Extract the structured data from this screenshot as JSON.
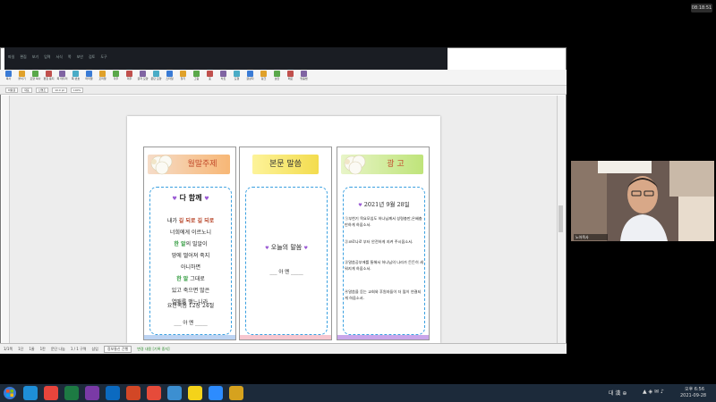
{
  "clock_top": "08:18:51",
  "word": {
    "menu_tabs": [
      "파일",
      "편집",
      "보기",
      "입력",
      "서식",
      "쪽",
      "보안",
      "검토",
      "도구"
    ],
    "ribbon_labels": [
      "복사",
      "붙이기",
      "모양 복사",
      "편집 용지",
      "쪽 테두리",
      "쪽 번호",
      "머리말",
      "꼬리말",
      "각주",
      "미주",
      "글자 모양",
      "문단 모양",
      "스타일",
      "찾기",
      "그림",
      "표",
      "차트",
      "도형",
      "글상자",
      "링크",
      "보안",
      "메모",
      "맞춤법"
    ],
    "format_fields": [
      "바탕글",
      "대표",
      "신명조",
      "10.0 pt",
      "100%"
    ],
    "status": {
      "items": [
        "1/1쪽",
        "1단",
        "1줄",
        "1칸",
        "문단 나눔",
        "1 / 1 구역",
        "삽입"
      ],
      "tab": "정보통신 간행",
      "change_tracking": "변경 내용 [기록 중지]"
    }
  },
  "bulletin": {
    "theme": {
      "title": "월말주제",
      "heading": "다 함께",
      "poem_lines": [
        {
          "pre": "내가 ",
          "hl": "길 되로 길 되로",
          "post": ""
        },
        {
          "pre": "너희에게 이르노니",
          "hl": "",
          "post": ""
        },
        {
          "pre": "",
          "hl": "한 알",
          "post": "의 밀알이"
        },
        {
          "pre": "땅에 떨어져 죽지",
          "hl": "",
          "post": ""
        },
        {
          "pre": "아니하면",
          "hl": "",
          "post": ""
        },
        {
          "pre": "",
          "hl": "한 알",
          "post": " 그대로"
        },
        {
          "pre": "있고 죽으면 많은",
          "hl": "",
          "post": ""
        },
        {
          "pre": "열매를 맺느니라.",
          "hl": "",
          "post": ""
        }
      ],
      "reference": "요한복음 12장 24절",
      "amen": "아 멘"
    },
    "scripture": {
      "title": "본문 말씀",
      "text": "오늘의 말씀",
      "amen": "아 멘"
    },
    "notice": {
      "title": "광  고",
      "date": "2021년 9월 28일",
      "items": [
        "①부천기 목요모임도 하나님께서 성령충만,은혜충만하게 하옵소서.",
        "②코로나로 부터 안전하게 지켜 주시옵소서.",
        "③말씀공부에를 통해서 하나님의 나라가 든든히 세워지게 하옵소서.",
        "④말씀을 듣는 교회와 후원자들이 더 많이 연결되게 하옵소서."
      ]
    }
  },
  "webcam_label": "노아목사",
  "taskbar": {
    "apps": [
      "IE",
      "Chrome",
      "Excel",
      "OneNote",
      "Outlook",
      "PowerPoint",
      "Viewer",
      "Hangul",
      "KakaoTalk",
      "Zoom",
      "Photos"
    ],
    "ime": "대 漢 ⊕",
    "time": "오후 6:56",
    "date": "2021-09-28"
  }
}
